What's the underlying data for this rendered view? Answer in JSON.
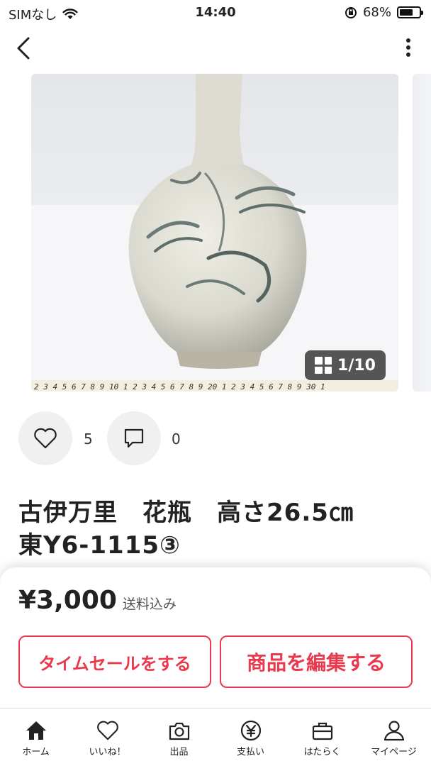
{
  "status_bar": {
    "carrier": "SIMなし",
    "time": "14:40",
    "battery": "68%",
    "battery_level": 0.68
  },
  "gallery": {
    "counter": "1/10",
    "ruler_text": "2 3 4 5 6 7 8 9 10 1 2 3 4 5 6 7 8 9 20 1 2 3 4 5 6 7 8 9 30 1"
  },
  "actions": {
    "likes": "5",
    "comments": "0"
  },
  "item": {
    "title_line1": "古伊万里　花瓶　高さ26.5㎝",
    "title_line2": "東Y6-1115③"
  },
  "purchase": {
    "price": "¥3,000",
    "shipping_note": "送料込み",
    "time_sale_button": "タイムセールをする",
    "edit_button": "商品を編集する"
  },
  "tabs": [
    {
      "label": "ホーム",
      "icon": "home-icon"
    },
    {
      "label": "いいね！",
      "icon": "heart-icon"
    },
    {
      "label": "出品",
      "icon": "camera-icon"
    },
    {
      "label": "支払い",
      "icon": "yen-icon"
    },
    {
      "label": "はたらく",
      "icon": "briefcase-icon"
    },
    {
      "label": "マイページ",
      "icon": "user-icon"
    }
  ],
  "colors": {
    "accent": "#e8394d",
    "text": "#222222",
    "action_bg": "#f0f0f0"
  }
}
